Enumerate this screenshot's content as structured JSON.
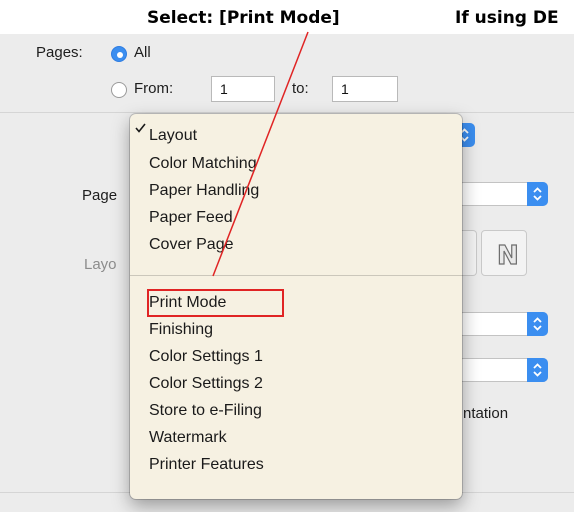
{
  "annotation": {
    "left": "Select:  [Print Mode]",
    "right": "If using DE"
  },
  "pages": {
    "label": "Pages:",
    "all_label": "All",
    "from_label": "From:",
    "from_value": "1",
    "to_label": "to:",
    "to_value": "1",
    "selected": "All"
  },
  "background_labels": {
    "page": "Page",
    "layout": "Layo",
    "orientation": "ntation"
  },
  "menu": {
    "items_top": [
      {
        "label": "Layout",
        "checked": true
      },
      {
        "label": "Color Matching",
        "checked": false
      },
      {
        "label": "Paper Handling",
        "checked": false
      },
      {
        "label": "Paper Feed",
        "checked": false
      },
      {
        "label": "Cover Page",
        "checked": false
      }
    ],
    "items_bottom": [
      {
        "label": "Print Mode",
        "highlighted": true
      },
      {
        "label": "Finishing"
      },
      {
        "label": "Color Settings 1"
      },
      {
        "label": "Color Settings 2"
      },
      {
        "label": "Store to e-Filing"
      },
      {
        "label": "Watermark"
      },
      {
        "label": "Printer Features"
      }
    ]
  },
  "colors": {
    "accent": "#3b8ef0",
    "menu_bg": "#f6f1e2",
    "highlight_box": "#e02424",
    "panel_bg": "#ececec"
  }
}
